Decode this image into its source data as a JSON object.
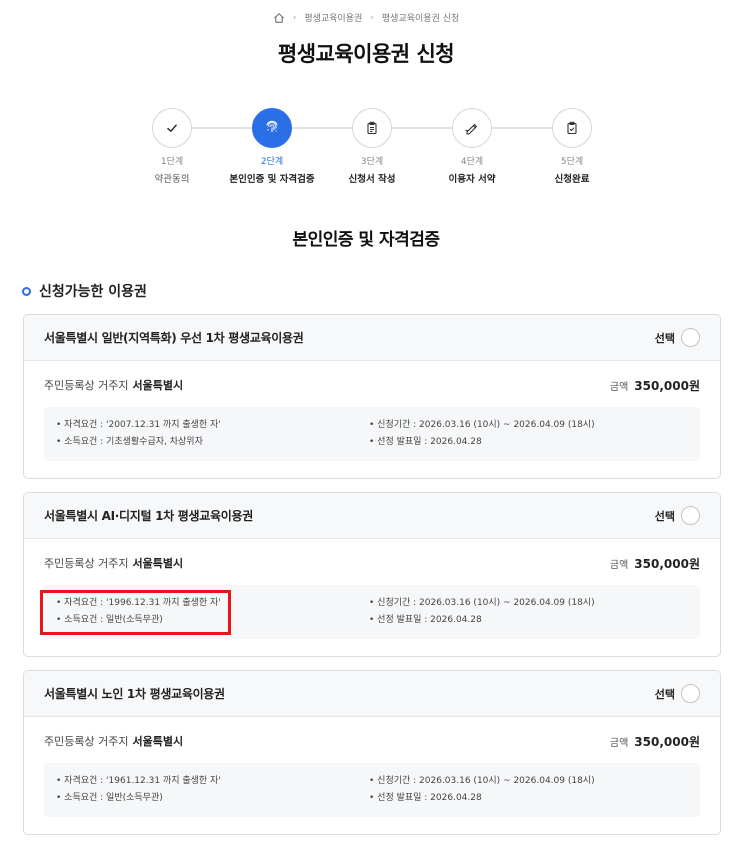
{
  "breadcrumb": {
    "items": [
      "평생교육이용권",
      "평생교육이용권 신청"
    ]
  },
  "page": {
    "title": "평생교육이용권 신청",
    "section_title": "본인인증 및 자격검증",
    "sub_heading": "신청가능한 이용권"
  },
  "steps": [
    {
      "num": "1단계",
      "name": "약관동의",
      "icon": "check-icon"
    },
    {
      "num": "2단계",
      "name": "본인인증 및 자격검증",
      "icon": "fingerprint-icon"
    },
    {
      "num": "3단계",
      "name": "신청서 작성",
      "icon": "clipboard-icon"
    },
    {
      "num": "4단계",
      "name": "이용자 서약",
      "icon": "pen-icon"
    },
    {
      "num": "5단계",
      "name": "신청완료",
      "icon": "clipboard-check-icon"
    }
  ],
  "colors": {
    "accent": "#2b6fe6",
    "highlight": "#e8151b"
  },
  "vouchers": [
    {
      "title": "서울특별시 일반(지역특화) 우선 1차 평생교육이용권",
      "select_label": "선택",
      "residence_label": "주민등록상 거주지",
      "residence_value": "서울특별시",
      "amount_label": "금액",
      "amount_value": "350,000원",
      "eligibility": "• 자격요건 : '2007.12.31 까지 출생한 자'",
      "income": "• 소득요건 : 기초생활수급자, 차상위자",
      "period": "• 신청기간 : 2026.03.16 (10시) ~ 2026.04.09 (18시)",
      "announce": "• 선정 발표일 : 2026.04.28"
    },
    {
      "title": "서울특별시 AI·디지털 1차 평생교육이용권",
      "select_label": "선택",
      "residence_label": "주민등록상 거주지",
      "residence_value": "서울특별시",
      "amount_label": "금액",
      "amount_value": "350,000원",
      "eligibility": "• 자격요건 : '1996.12.31 까지 출생한 자'",
      "income": "• 소득요건 : 일반(소득무관)",
      "period": "• 신청기간 : 2026.03.16 (10시) ~ 2026.04.09 (18시)",
      "announce": "• 선정 발표일 : 2026.04.28"
    },
    {
      "title": "서울특별시 노인 1차 평생교육이용권",
      "select_label": "선택",
      "residence_label": "주민등록상 거주지",
      "residence_value": "서울특별시",
      "amount_label": "금액",
      "amount_value": "350,000원",
      "eligibility": "• 자격요건 : '1961.12.31 까지 출생한 자'",
      "income": "• 소득요건 : 일반(소득무관)",
      "period": "• 신청기간 : 2026.03.16 (10시) ~ 2026.04.09 (18시)",
      "announce": "• 선정 발표일 : 2026.04.28"
    }
  ]
}
